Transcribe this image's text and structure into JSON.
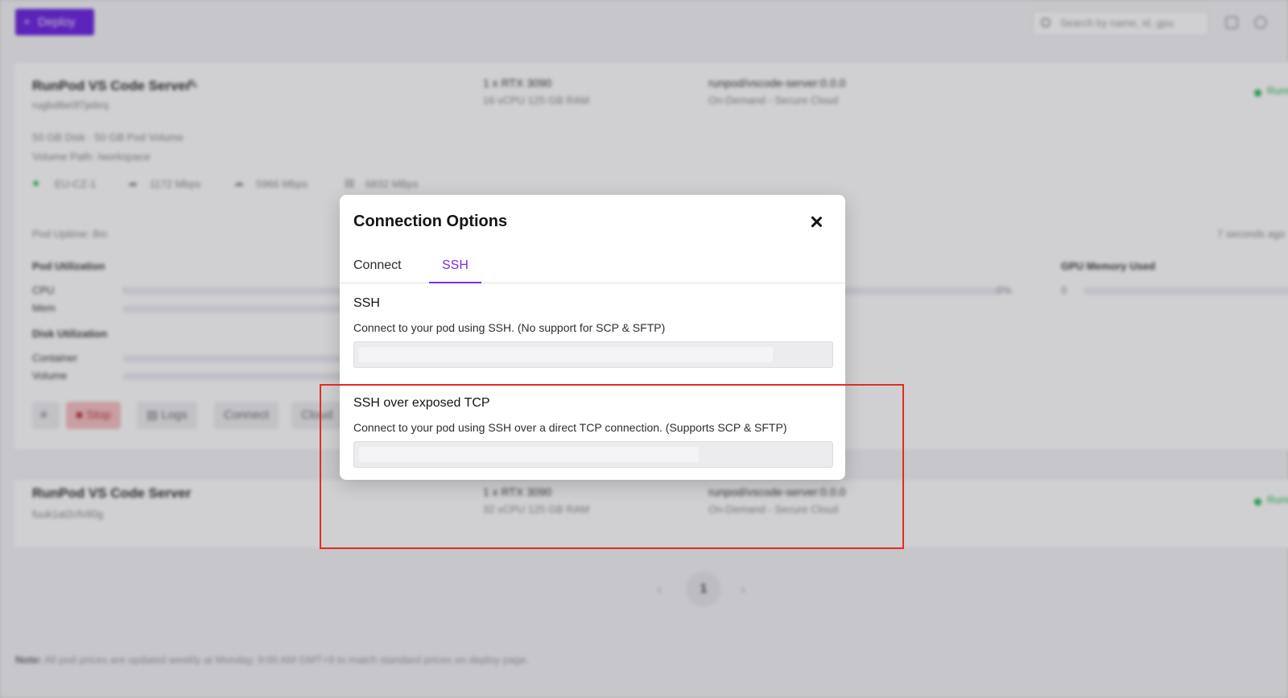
{
  "background": {
    "deploy_label": "Deploy",
    "search_placeholder": "Search by name, id, gpu",
    "pod1": {
      "name": "RunPod VS Code Server",
      "id": "rugbd6e0f7jebrq",
      "gpu": "1 x RTX 3090",
      "specs": "16 vCPU 125 GB RAM",
      "image": "runpod/vscode-server:0.0.0",
      "tier": "On-Demand - Secure Cloud",
      "status": "Running",
      "disk": "50 GB Disk · 50 GB Pod Volume",
      "volume_path": "Volume Path: /workspace",
      "region": "EU-CZ-1",
      "upload": "1172 Mbps",
      "download": "5966 Mbps",
      "disk_speed": "6832 MBps",
      "uptime": "Pod Uptime: 8m",
      "updated": "7 seconds ago",
      "pod_utilization": "Pod Utilization",
      "cpu_label": "CPU",
      "mem_label": "Mem",
      "disk_utilization": "Disk Utilization",
      "container_label": "Container",
      "volume_label": "Volume",
      "gpu_util_pct": "0%",
      "gpu_memory_label": "GPU Memory Used",
      "gpu_memory_value": "0",
      "buttons": {
        "stop": "Stop",
        "logs": "Logs",
        "connect": "Connect",
        "cloud": "Cloud"
      }
    },
    "pod2": {
      "name": "RunPod VS Code Server",
      "id": "fuuk1at2cfv90g",
      "gpu": "1 x RTX 3090",
      "specs": "32 vCPU 125 GB RAM",
      "image": "runpod/vscode-server:0.0.0",
      "tier": "On-Demand - Secure Cloud",
      "status": "Running"
    },
    "pagination": {
      "current": "1",
      "prev": "‹",
      "next": "›"
    },
    "note_label": "Note:",
    "note_text": " All pod prices are updated weekly at Monday, 9:00 AM GMT+9 to match standard prices on deploy page."
  },
  "modal": {
    "title": "Connection Options",
    "tabs": [
      {
        "label": "Connect",
        "active": false
      },
      {
        "label": "SSH",
        "active": true
      }
    ],
    "sections": [
      {
        "title": "SSH",
        "description": "Connect to your pod using SSH. (No support for SCP & SFTP)",
        "command_value": ""
      },
      {
        "title": "SSH over exposed TCP",
        "description": "Connect to your pod using SSH over a direct TCP connection. (Supports SCP & SFTP)",
        "command_value": ""
      }
    ]
  },
  "colors": {
    "accent": "#7a2fe0",
    "deploy_button": "#6a22e0",
    "highlight": "#e52b23",
    "status_running": "#2dbb55"
  }
}
